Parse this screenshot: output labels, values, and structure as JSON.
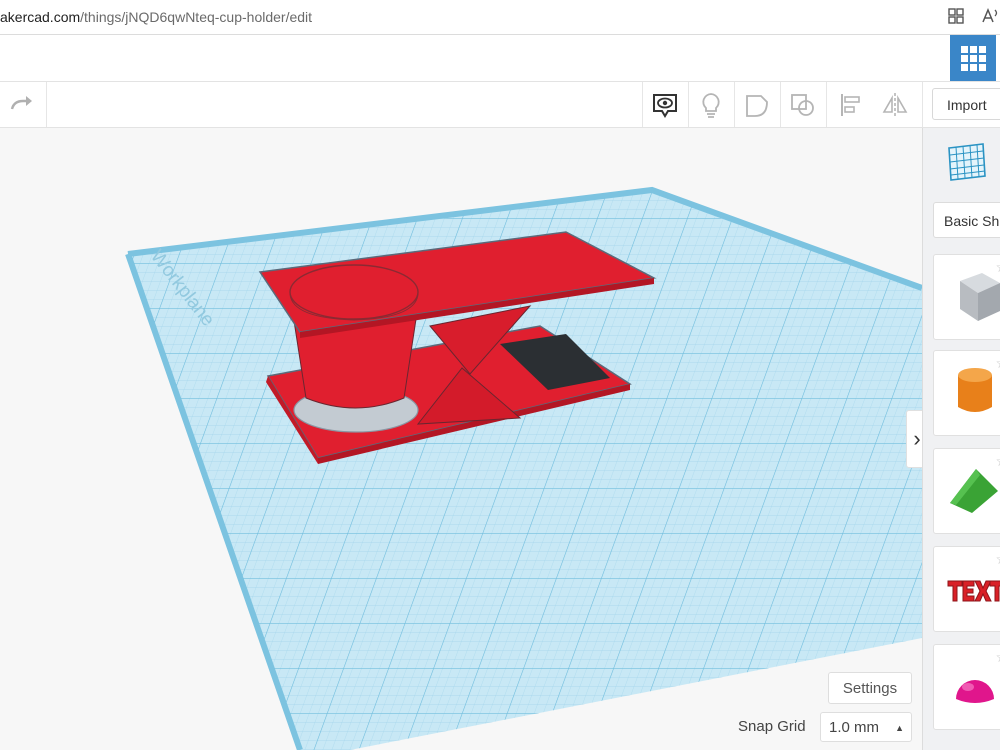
{
  "browser": {
    "url_host": "akercad.com",
    "url_path": "/things/jNQD6qwNteq-cup-holder/edit",
    "icons": [
      "tab-grid-icon",
      "read-aloud-icon"
    ]
  },
  "header": {
    "apps_icon": "grid-apps-icon"
  },
  "toolbar": {
    "redo_icon": "redo-icon",
    "icons": [
      "view-notes-icon",
      "light-bulb-icon",
      "group-icon",
      "ungroup-icon",
      "align-icon",
      "mirror-icon"
    ],
    "import_label": "Import"
  },
  "workplane": {
    "watermark": "Workplane",
    "colors": {
      "grid": "#7fc6e3",
      "plane": "#bfe3f3",
      "shape_red": "#e01f2f",
      "hole_gray": "#c3cbd2",
      "dark_slot": "#2b2f33"
    }
  },
  "right_panel": {
    "workplane_icon": "workplane-icon",
    "category": "Basic Sh",
    "shapes": [
      {
        "name": "Box",
        "icon": "box-hole-icon",
        "color": "#b8bcc1"
      },
      {
        "name": "Cylinder",
        "icon": "cylinder-icon",
        "color": "#e8801a"
      },
      {
        "name": "Roof",
        "icon": "roof-icon",
        "color": "#3aa335"
      },
      {
        "name": "Text",
        "icon": "text-icon",
        "color": "#d92027"
      },
      {
        "name": "Half Sphere",
        "icon": "half-sphere-icon",
        "color": "#e0168c"
      }
    ]
  },
  "footer": {
    "settings_label": "Settings",
    "snap_grid_label": "Snap Grid",
    "snap_grid_value": "1.0 mm"
  }
}
